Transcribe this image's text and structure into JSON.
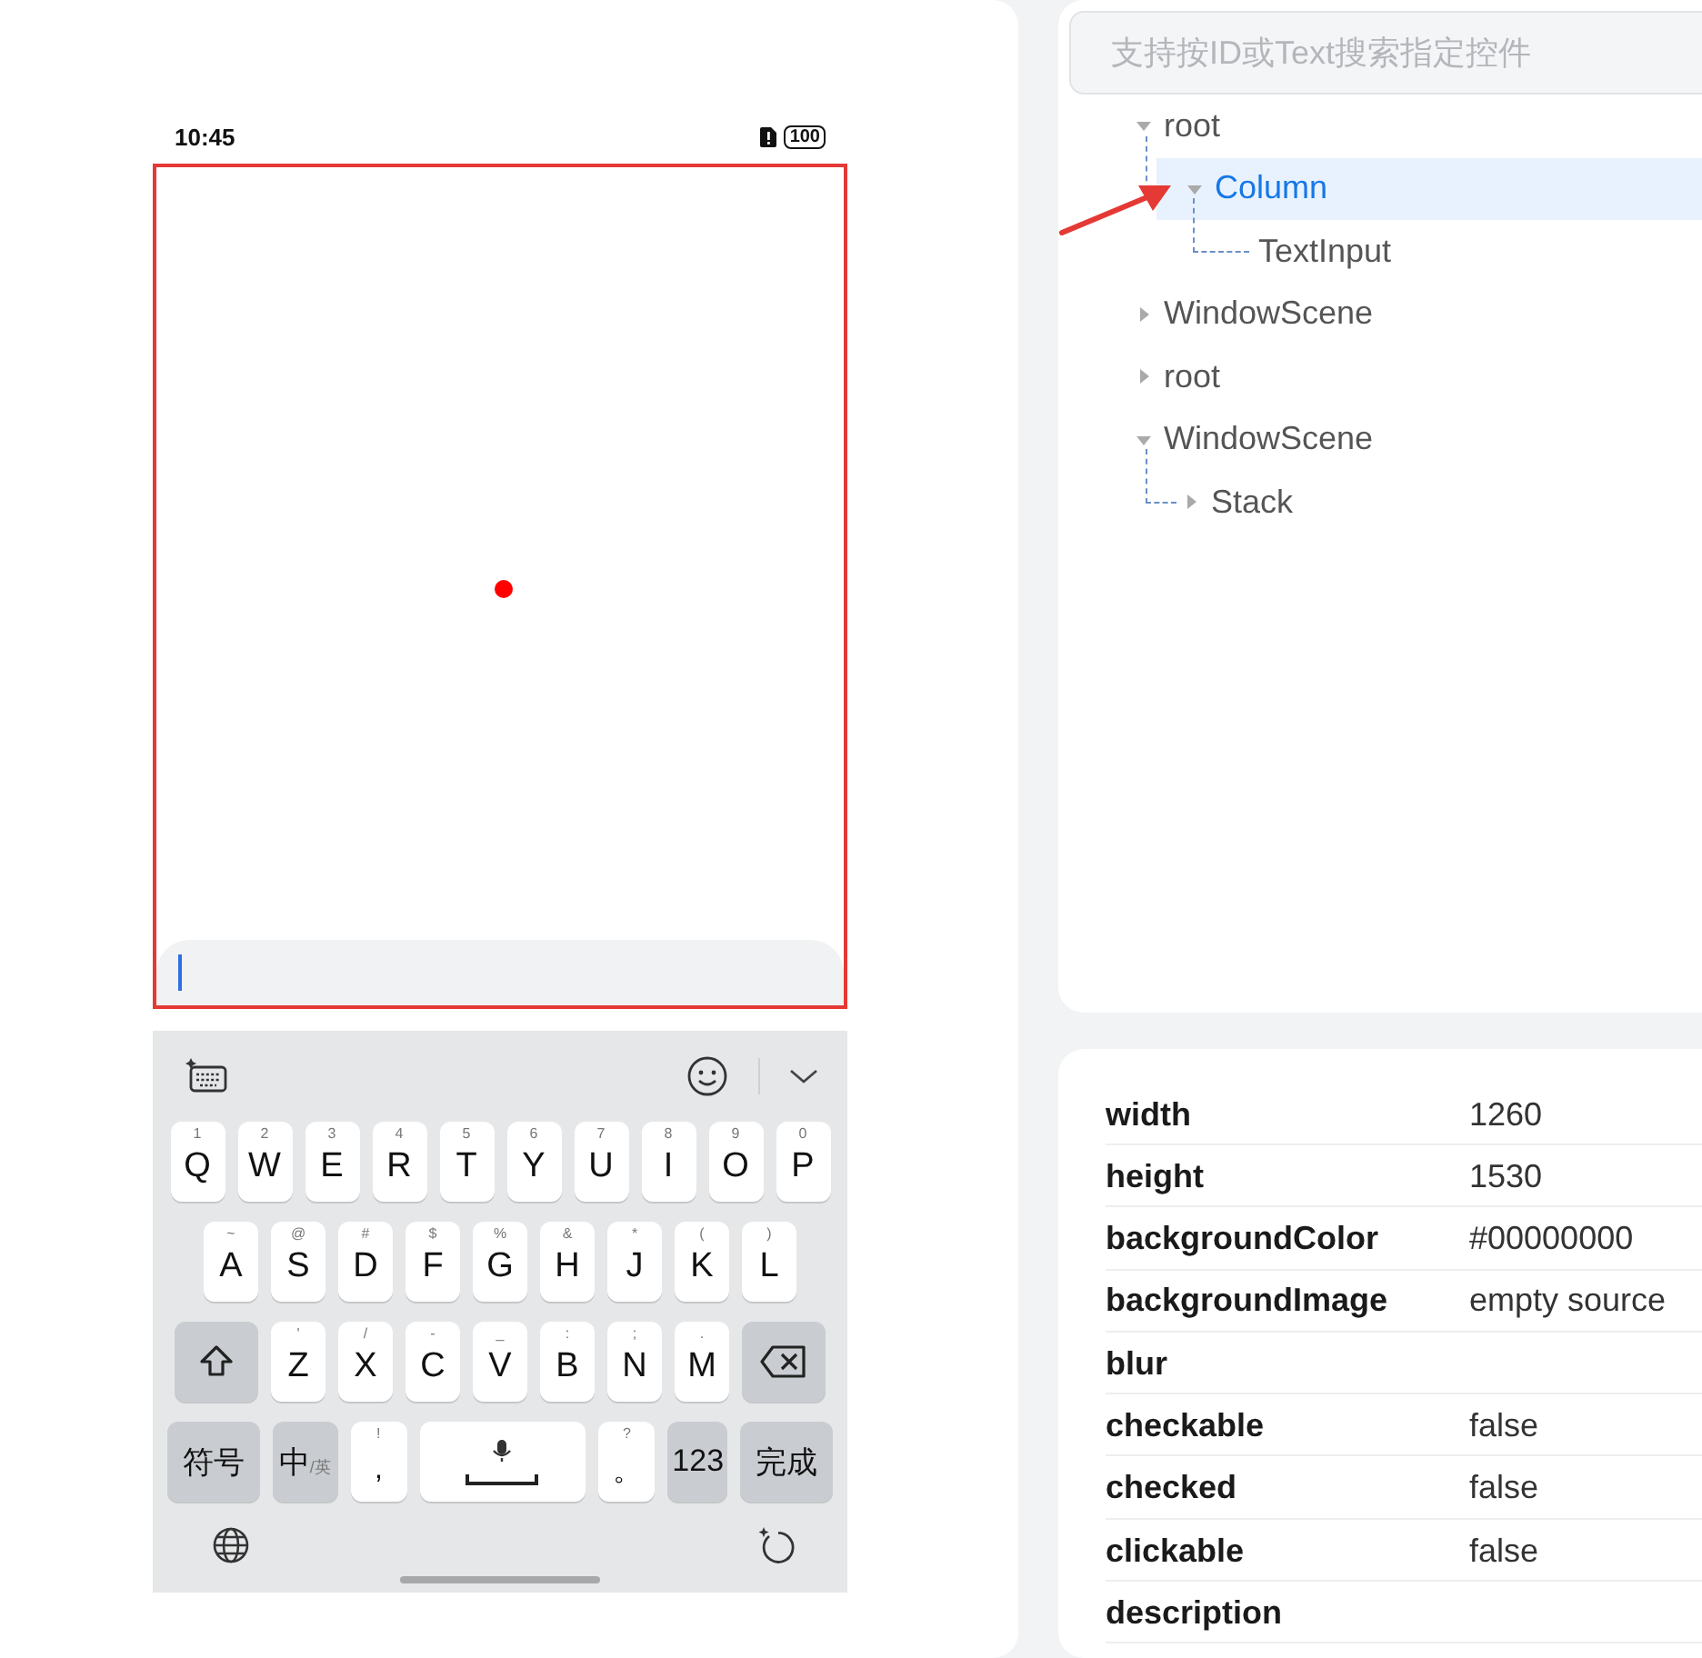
{
  "phone": {
    "status_bar": {
      "time": "10:45",
      "battery": "100"
    },
    "text_input": {
      "focused": true
    },
    "keyboard": {
      "rows": [
        {
          "keys": [
            {
              "kind": "letter",
              "label": "Q",
              "hint": "1"
            },
            {
              "kind": "letter",
              "label": "W",
              "hint": "2"
            },
            {
              "kind": "letter",
              "label": "E",
              "hint": "3"
            },
            {
              "kind": "letter",
              "label": "R",
              "hint": "4"
            },
            {
              "kind": "letter",
              "label": "T",
              "hint": "5"
            },
            {
              "kind": "letter",
              "label": "Y",
              "hint": "6"
            },
            {
              "kind": "letter",
              "label": "U",
              "hint": "7"
            },
            {
              "kind": "letter",
              "label": "I",
              "hint": "8"
            },
            {
              "kind": "letter",
              "label": "O",
              "hint": "9"
            },
            {
              "kind": "letter",
              "label": "P",
              "hint": "0"
            }
          ]
        },
        {
          "keys": [
            {
              "kind": "letter",
              "label": "A",
              "hint": "~"
            },
            {
              "kind": "letter",
              "label": "S",
              "hint": "@"
            },
            {
              "kind": "letter",
              "label": "D",
              "hint": "#"
            },
            {
              "kind": "letter",
              "label": "F",
              "hint": "$"
            },
            {
              "kind": "letter",
              "label": "G",
              "hint": "%"
            },
            {
              "kind": "letter",
              "label": "H",
              "hint": "&"
            },
            {
              "kind": "letter",
              "label": "J",
              "hint": "*"
            },
            {
              "kind": "letter",
              "label": "K",
              "hint": "("
            },
            {
              "kind": "letter",
              "label": "L",
              "hint": ")"
            }
          ]
        },
        {
          "keys": [
            {
              "kind": "shift"
            },
            {
              "kind": "letter",
              "label": "Z",
              "hint": "'"
            },
            {
              "kind": "letter",
              "label": "X",
              "hint": "/"
            },
            {
              "kind": "letter",
              "label": "C",
              "hint": "-"
            },
            {
              "kind": "letter",
              "label": "V",
              "hint": "_"
            },
            {
              "kind": "letter",
              "label": "B",
              "hint": ":"
            },
            {
              "kind": "letter",
              "label": "N",
              "hint": ";"
            },
            {
              "kind": "letter",
              "label": "M",
              "hint": "."
            },
            {
              "kind": "backspace"
            }
          ]
        },
        {
          "keys": [
            {
              "kind": "symbols",
              "label": "符号"
            },
            {
              "kind": "lang",
              "label": "中",
              "sub": "/英"
            },
            {
              "kind": "punct",
              "label": ",",
              "hint": "!"
            },
            {
              "kind": "space"
            },
            {
              "kind": "punct",
              "label": "。",
              "hint": "?"
            },
            {
              "kind": "numbers",
              "label": "123"
            },
            {
              "kind": "done",
              "label": "完成"
            }
          ]
        }
      ]
    }
  },
  "inspector": {
    "search": {
      "placeholder": "支持按ID或Text搜索指定控件"
    },
    "tree": [
      {
        "label": "root",
        "expanded": true,
        "selected": false,
        "children": [
          {
            "label": "Column",
            "expanded": true,
            "selected": true,
            "children": [
              {
                "label": "TextInput",
                "selected": false
              }
            ]
          }
        ]
      },
      {
        "label": "WindowScene",
        "expanded": false,
        "selected": false
      },
      {
        "label": "root",
        "expanded": false,
        "selected": false
      },
      {
        "label": "WindowScene",
        "expanded": true,
        "selected": false,
        "children": [
          {
            "label": "Stack",
            "expanded": false,
            "selected": false
          }
        ]
      }
    ],
    "properties": [
      {
        "name": "width",
        "value": "1260"
      },
      {
        "name": "height",
        "value": "1530"
      },
      {
        "name": "backgroundColor",
        "value": "#00000000"
      },
      {
        "name": "backgroundImage",
        "value": "empty source"
      },
      {
        "name": "blur"
      },
      {
        "name": "checkable",
        "value": "false"
      },
      {
        "name": "checked",
        "value": "false"
      },
      {
        "name": "clickable",
        "value": "false"
      },
      {
        "name": "description"
      }
    ]
  }
}
